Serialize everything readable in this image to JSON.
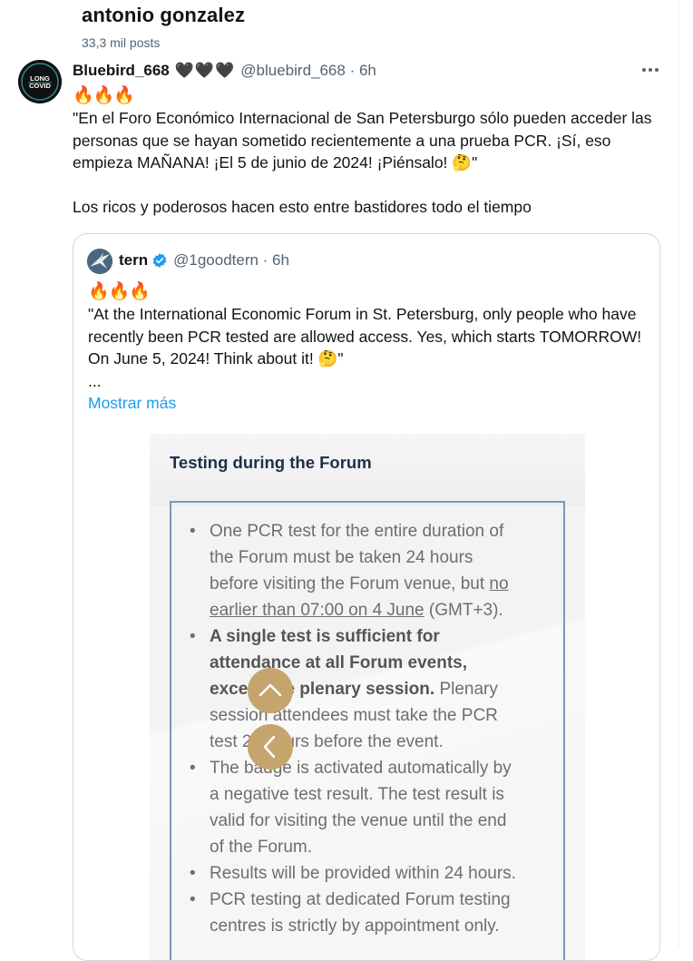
{
  "profile": {
    "name": "antonio gonzalez",
    "post_count": "33,3 mil posts"
  },
  "tweet": {
    "avatar_text": "LONG COVID",
    "display_name": "Bluebird_668",
    "hearts": "🖤🖤🖤",
    "handle_time": "@bluebird_668 · 6h",
    "fires": "🔥🔥🔥",
    "text_p1": "\"En el Foro Económico Internacional de San Petersburgo sólo pueden acceder las personas que se hayan sometido recientemente a una prueba PCR. ¡Sí, eso empieza MAÑANA! ¡El 5 de junio de 2024! ¡Piénsalo! 🤔\"",
    "text_p2": "Los ricos y poderosos hacen esto entre bastidores todo el tiempo"
  },
  "quote": {
    "display_name": "tern",
    "handle_time": "@1goodtern · 6h",
    "fires": "🔥🔥🔥",
    "text": "\"At the International Economic Forum in St. Petersburg, only people who have recently been PCR tested are allowed access.  Yes, which starts TOMORROW! On June 5, 2024! Think about it! 🤔\"",
    "ellipsis": "...",
    "show_more": "Mostrar más"
  },
  "media": {
    "title": "Testing during the Forum",
    "items": [
      {
        "a": "One PCR test for the entire duration of the Forum must be taken 24 hours before visiting the Forum venue, but ",
        "u": "no earlier than 07:00 on 4 June",
        "b": " (GMT+3)."
      },
      {
        "bold": "A single test is sufficient for attendance at all Forum events, except the plenary session.",
        "rest": " Plenary session attendees must take the PCR test 24 hours before the event."
      },
      {
        "text": "The badge is activated automatically by a negative test result. The test result is valid for visiting the venue until the end of the Forum."
      },
      {
        "text": "Results will be provided within 24 hours."
      },
      {
        "text": "PCR testing at dedicated Forum testing centres is strictly by appointment only."
      }
    ]
  },
  "colors": {
    "link": "#1d9bf0",
    "secondary_text": "#536471",
    "nav_button": "#c5a46e",
    "doc_border": "#7c97b6",
    "doc_title": "#1f2f4b"
  },
  "icons": {
    "more": "more-horizontal-icon",
    "verified": "verified-badge-icon",
    "up": "chevron-up-icon",
    "left": "chevron-left-icon"
  }
}
